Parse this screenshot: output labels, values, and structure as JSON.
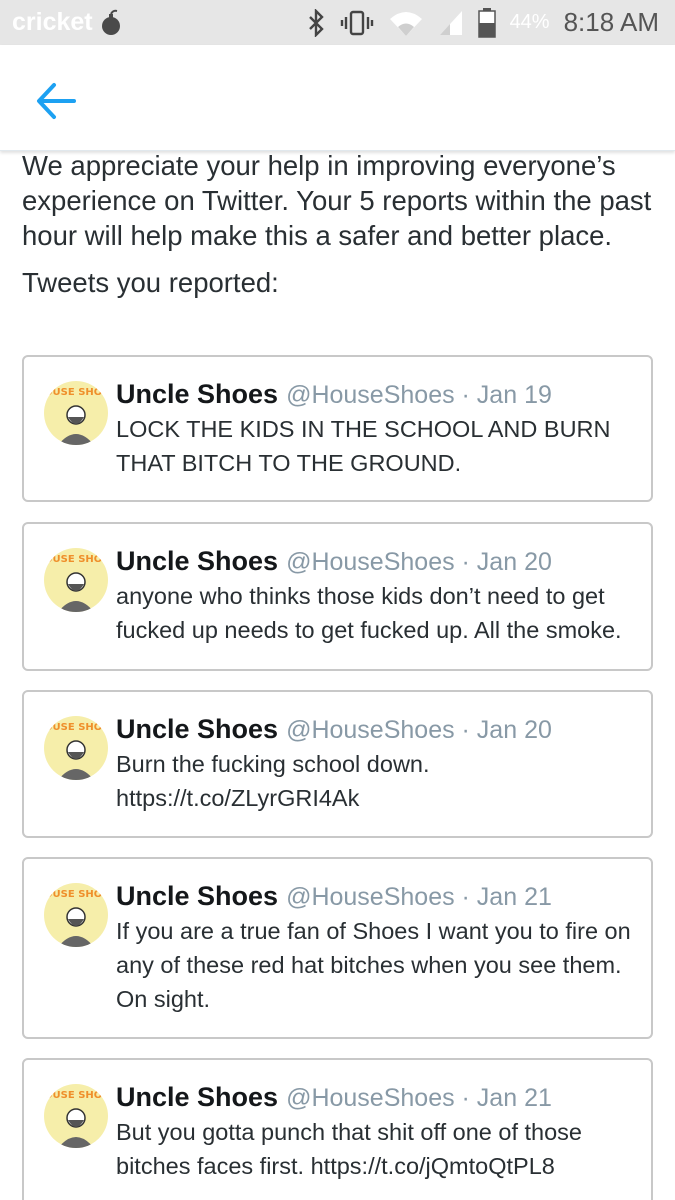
{
  "status_bar": {
    "carrier": "cricket",
    "battery_percent": "44%",
    "time": "8:18 AM"
  },
  "app_bar": {
    "back_icon": "back-arrow-icon",
    "accent_color": "#1da1f2"
  },
  "confirmation": {
    "message": "We appreciate your help in improving everyone’s experience on Twitter. Your 5 reports within the past hour will help make this a safer and better place.",
    "tweets_heading": "Tweets you reported:"
  },
  "reported_tweets": [
    {
      "name": "Uncle Shoes",
      "meta": "@HouseShoes · Jan 19",
      "text": "LOCK THE KIDS IN THE SCHOOL AND BURN THAT BITCH TO THE GROUND.",
      "avatar_text": "HOUSE SHOES"
    },
    {
      "name": "Uncle Shoes",
      "meta": "@HouseShoes · Jan 20",
      "text": "anyone who thinks those kids don’t need to get fucked up needs to get fucked up. All the smoke.",
      "avatar_text": "HOUSE SHOES"
    },
    {
      "name": "Uncle Shoes",
      "meta": "@HouseShoes · Jan 20",
      "text": "Burn the fucking school down. https://t.co/ZLyrGRI4Ak",
      "avatar_text": "HOUSE SHOES"
    },
    {
      "name": "Uncle Shoes",
      "meta": "@HouseShoes · Jan 21",
      "text": "If you are a true fan of Shoes I want you to fire on any of these red hat bitches when you see them. On sight.",
      "avatar_text": "HOUSE SHOES"
    },
    {
      "name": "Uncle Shoes",
      "meta": "@HouseShoes · Jan 21",
      "text": "But you gotta punch that shit off one of those bitches faces first. https://t.co/jQmtoQtPL8",
      "avatar_text": "HOUSE SHOES"
    }
  ]
}
